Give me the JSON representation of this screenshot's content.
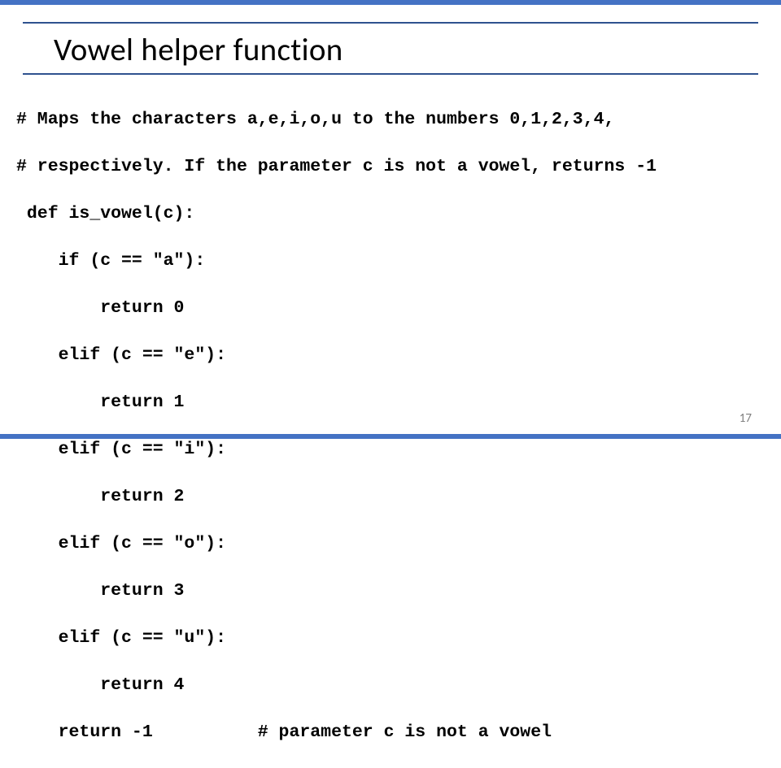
{
  "slide": {
    "title": "Vowel helper function",
    "page_number": "17"
  },
  "code": {
    "lines": [
      "# Maps the characters a,e,i,o,u to the numbers 0,1,2,3,4,",
      "# respectively. If the parameter c is not a vowel, returns -1",
      " def is_vowel(c):",
      "    if (c == \"a\"):",
      "        return 0",
      "    elif (c == \"e\"):",
      "        return 1",
      "    elif (c == \"i\"):",
      "        return 2",
      "    elif (c == \"o\"):",
      "        return 3",
      "    elif (c == \"u\"):",
      "        return 4",
      "    return -1          # parameter c is not a vowel"
    ]
  },
  "colors": {
    "accent": "#4472c4",
    "line": "#2f528f",
    "text": "#000000",
    "page_num": "#7f7f7f"
  }
}
